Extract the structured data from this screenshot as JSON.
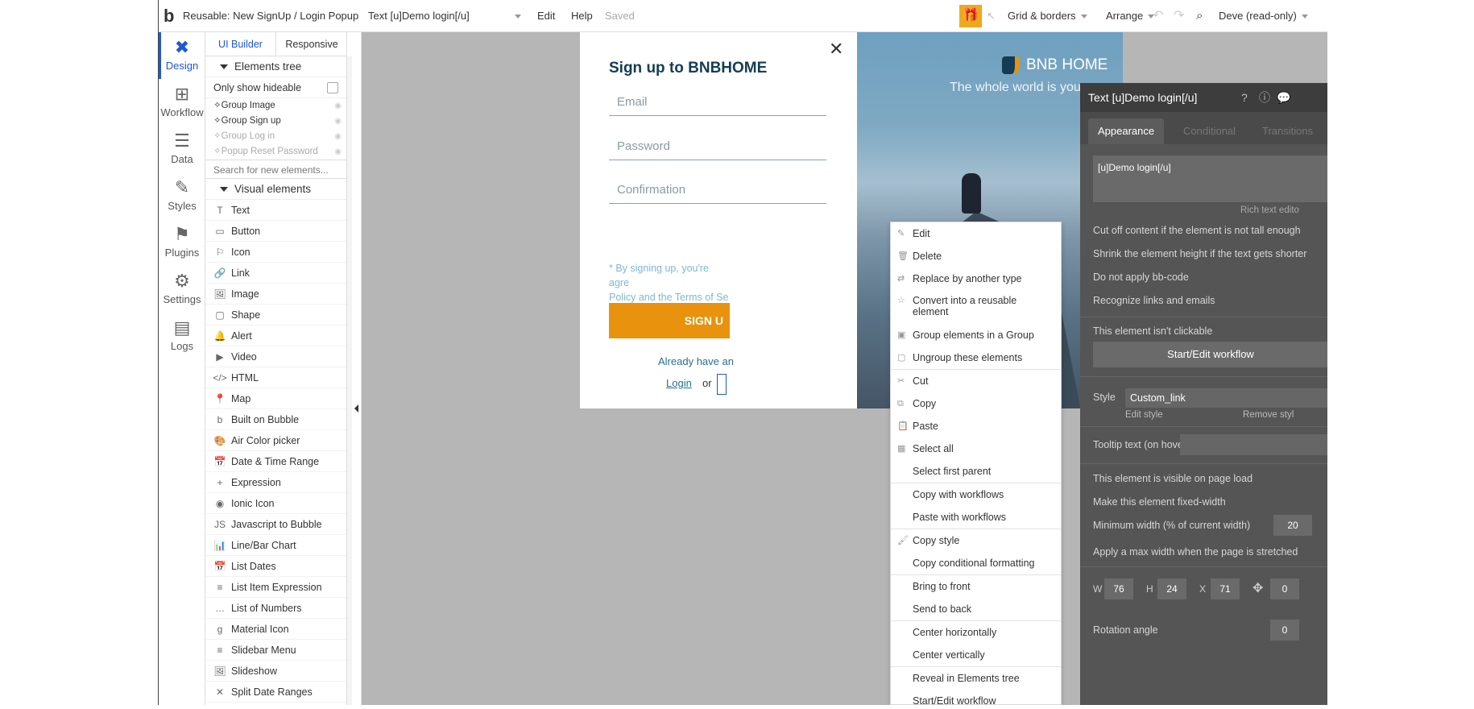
{
  "topbar": {
    "logo": "b",
    "page_selector": "Reusable: New SignUp / Login Popup",
    "element_selector": "Text [u]Demo login[/u]",
    "menu_edit": "Edit",
    "menu_help": "Help",
    "status": "Saved",
    "grid_borders": "Grid & borders",
    "arrange": "Arrange",
    "user": "Deve (read-only)"
  },
  "leftnav": {
    "items": [
      {
        "label": "Design",
        "icon": "design-icon"
      },
      {
        "label": "Workflow",
        "icon": "workflow-icon"
      },
      {
        "label": "Data",
        "icon": "database-icon"
      },
      {
        "label": "Styles",
        "icon": "brush-icon"
      },
      {
        "label": "Plugins",
        "icon": "plugin-icon"
      },
      {
        "label": "Settings",
        "icon": "gear-icon"
      },
      {
        "label": "Logs",
        "icon": "document-icon"
      }
    ]
  },
  "palette": {
    "tab_ui_builder": "UI Builder",
    "tab_responsive": "Responsive",
    "elements_tree": "Elements tree",
    "only_show_hideable": "Only show hideable",
    "tree_items": [
      "Group Image",
      "Group Sign up",
      "Group Log in",
      "Popup Reset Password"
    ],
    "search_placeholder": "Search for new elements...",
    "visual_elements": "Visual elements",
    "visual_items": [
      "Text",
      "Button",
      "Icon",
      "Link",
      "Image",
      "Shape",
      "Alert",
      "Video",
      "HTML",
      "Map",
      "Built on Bubble",
      "Air Color picker",
      "Date & Time Range",
      "Expression",
      "Ionic Icon",
      "Javascript to Bubble",
      "Line/Bar Chart",
      "List Dates",
      "List Item Expression",
      "List of Numbers",
      "Material Icon",
      "Slidebar Menu",
      "Slideshow",
      "Split Date Ranges"
    ]
  },
  "popup": {
    "title": "Sign up to BNBHOME",
    "email_placeholder": "Email",
    "password_placeholder": "Password",
    "confirmation_placeholder": "Confirmation",
    "terms_line1": "* By signing up, you're agre",
    "terms_line2": "Policy and the Terms of Se",
    "signup_button": "SIGN U",
    "already": "Already have an",
    "login_link": "Login",
    "or": "or"
  },
  "hero": {
    "brand": "BNB HOME",
    "subtitle": "The whole world is yours"
  },
  "context_menu": {
    "items": [
      {
        "label": "Edit",
        "icon": "✎"
      },
      {
        "label": "Delete",
        "icon": "🗑"
      },
      {
        "label": "Replace by another type",
        "icon": "⇄"
      },
      {
        "label": "Convert into a reusable element",
        "icon": "☆",
        "two_line": true
      },
      {
        "label": "Group elements in a Group",
        "icon": "▣"
      },
      {
        "label": "Ungroup these elements",
        "icon": "▢",
        "sep_after": true
      },
      {
        "label": "Cut",
        "icon": "✂"
      },
      {
        "label": "Copy",
        "icon": "⧉"
      },
      {
        "label": "Paste",
        "icon": "📋"
      },
      {
        "label": "Select all",
        "icon": "▦"
      },
      {
        "label": "Select first parent",
        "icon": "",
        "sep_after": true
      },
      {
        "label": "Copy with workflows",
        "icon": ""
      },
      {
        "label": "Paste with workflows",
        "icon": "",
        "sep_after": true
      },
      {
        "label": "Copy style",
        "icon": "🖌"
      },
      {
        "label": "Copy conditional formatting",
        "icon": "",
        "sep_after": true
      },
      {
        "label": "Bring to front",
        "icon": ""
      },
      {
        "label": "Send to back",
        "icon": "",
        "sep_after": true
      },
      {
        "label": "Center horizontally",
        "icon": ""
      },
      {
        "label": "Center vertically",
        "icon": "",
        "sep_after": true
      },
      {
        "label": "Reveal in Elements tree",
        "icon": ""
      },
      {
        "label": "Start/Edit workflow",
        "icon": ""
      }
    ]
  },
  "property_editor": {
    "title": "Text [u]Demo login[/u]",
    "tabs": [
      "Appearance",
      "Conditional",
      "Transitions"
    ],
    "text_content": "[u]Demo login[/u]",
    "rich_text": "Rich text edito",
    "cut_off": "Cut off content if the element is not tall enough",
    "shrink": "Shrink the element height if the text gets shorter",
    "no_bbcode": "Do not apply bb-code",
    "recognize_links": "Recognize links and emails",
    "not_clickable": "This element isn't clickable",
    "workflow_button": "Start/Edit workflow",
    "style_label": "Style",
    "style_value": "Custom_link",
    "edit_style": "Edit style",
    "remove_style": "Remove styl",
    "tooltip_label": "Tooltip text (on hover)",
    "visible_on_load": "This element is visible on page load",
    "fixed_width": "Make this element fixed-width",
    "min_width_label": "Minimum width (% of current width)",
    "min_width_value": "20",
    "max_width_label": "Apply a max width when the page is stretched",
    "w_label": "W",
    "w_value": "76",
    "h_label": "H",
    "h_value": "24",
    "x_label": "X",
    "x_value": "71",
    "y_value": "0",
    "rotation_label": "Rotation angle",
    "rotation_value": "0"
  }
}
